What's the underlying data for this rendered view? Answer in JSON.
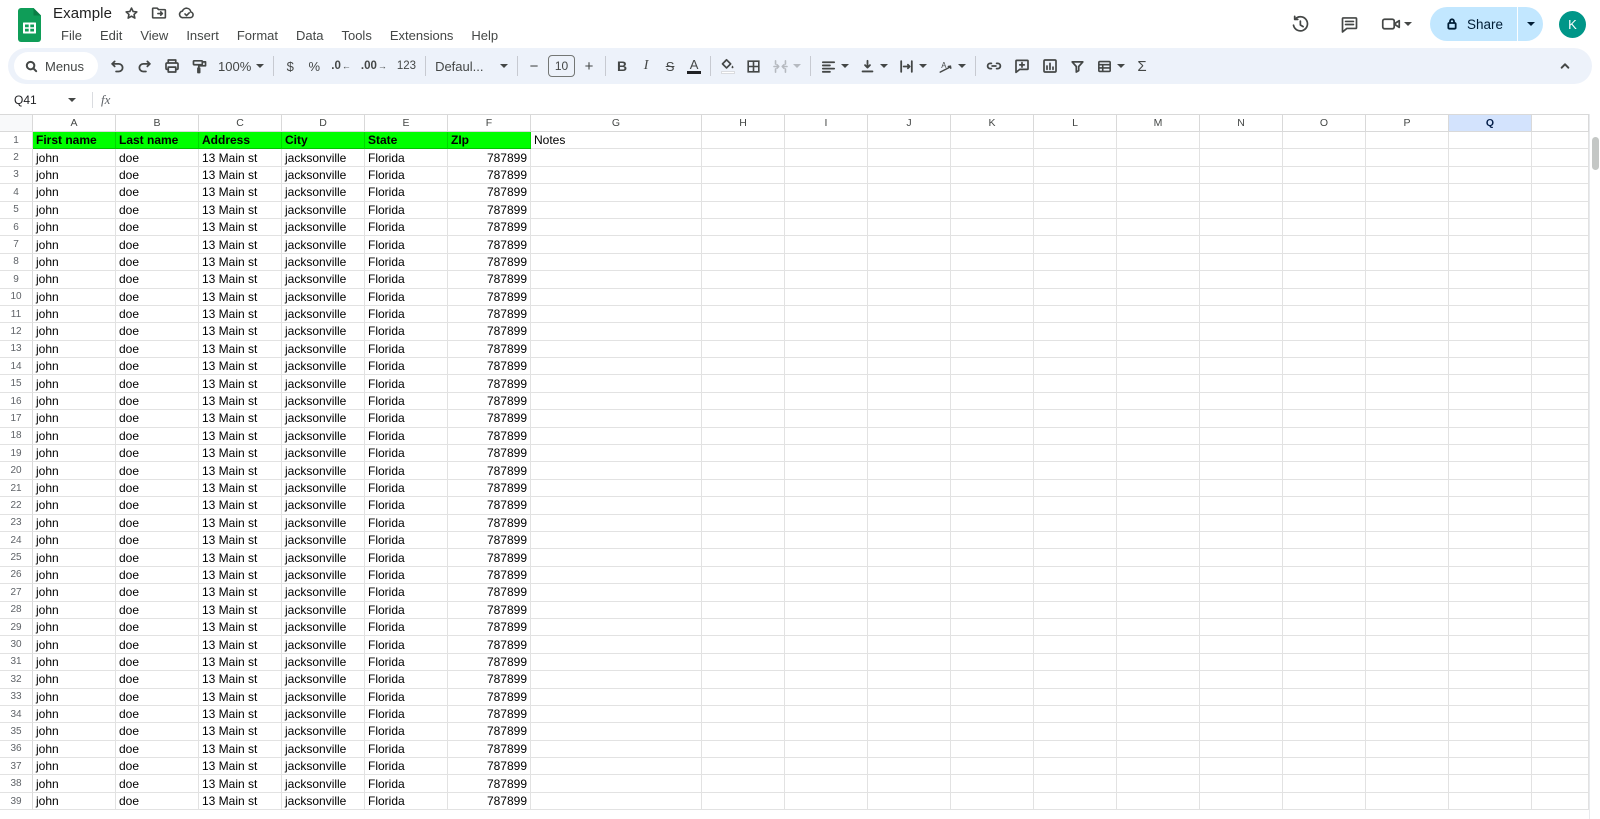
{
  "titlebar": {
    "title": "Example",
    "menus": [
      "File",
      "Edit",
      "View",
      "Insert",
      "Format",
      "Data",
      "Tools",
      "Extensions",
      "Help"
    ],
    "share_label": "Share",
    "avatar_initial": "K"
  },
  "toolbar": {
    "menus_label": "Menus",
    "zoom_value": "100%",
    "currency_label": "$",
    "percent_label": "%",
    "decrease_decimal_label": ".0",
    "increase_decimal_label": ".00",
    "more_formats_label": "123",
    "font_family_value": "Defaul...",
    "font_size_value": "10",
    "decrease_font_label": "−",
    "increase_font_label": "+",
    "bold_label": "B",
    "italic_label": "I",
    "strikethrough_label": "S",
    "text_color_label": "A",
    "functions_label": "Σ"
  },
  "formula_bar": {
    "cell_ref": "Q41",
    "fx_label": "fx",
    "value": ""
  },
  "sheet": {
    "columns": [
      "A",
      "B",
      "C",
      "D",
      "E",
      "F",
      "G",
      "H",
      "I",
      "J",
      "K",
      "L",
      "M",
      "N",
      "O",
      "P",
      "Q"
    ],
    "selected_column": "Q",
    "first_visible_row": 1,
    "last_visible_row": 39,
    "header_row": {
      "row": 1,
      "green_cells": [
        "First name",
        "Last name",
        "Address",
        "City",
        "State",
        "ZIp"
      ],
      "notes_cell": "Notes"
    },
    "data_rows": {
      "from_row": 2,
      "to_row": 39,
      "values": [
        "john",
        "doe",
        "13 Main st",
        "jacksonville",
        "Florida",
        "787899"
      ],
      "right_aligned_columns": [
        "F"
      ]
    }
  },
  "colors": {
    "header_green": "#00ff00",
    "selected_column_header_bg": "#d3e3fd",
    "share_button_bg": "#c2e7ff",
    "avatar_bg": "#009688",
    "logo_green": "#0f9d58",
    "toolbar_bg": "#edf2fa"
  },
  "icons": {
    "logo": "sheets-logo",
    "star": "star-outline",
    "move_folder": "folder-with-arrow",
    "cloud_saved": "cloud-with-check",
    "history": "clock-with-arrow",
    "comments": "speech-bubble",
    "video_call": "video-camera",
    "lock": "padlock",
    "search": "magnifier",
    "undo": "arrow-curved-left",
    "redo": "arrow-curved-right",
    "print": "printer",
    "paint_format": "paint-roller",
    "fill_color": "paint-bucket",
    "borders": "grid-squares",
    "merge": "merge-arrows",
    "align": "horizontal-lines",
    "valign": "arrow-down-to-line",
    "wrap": "arrow-between-bars",
    "rotate": "slanted-a",
    "link": "chain-links",
    "comment_add": "bubble-plus",
    "chart": "bar-chart-box",
    "filter": "funnel",
    "table_views": "table-grid",
    "collapse": "chevron-up"
  }
}
